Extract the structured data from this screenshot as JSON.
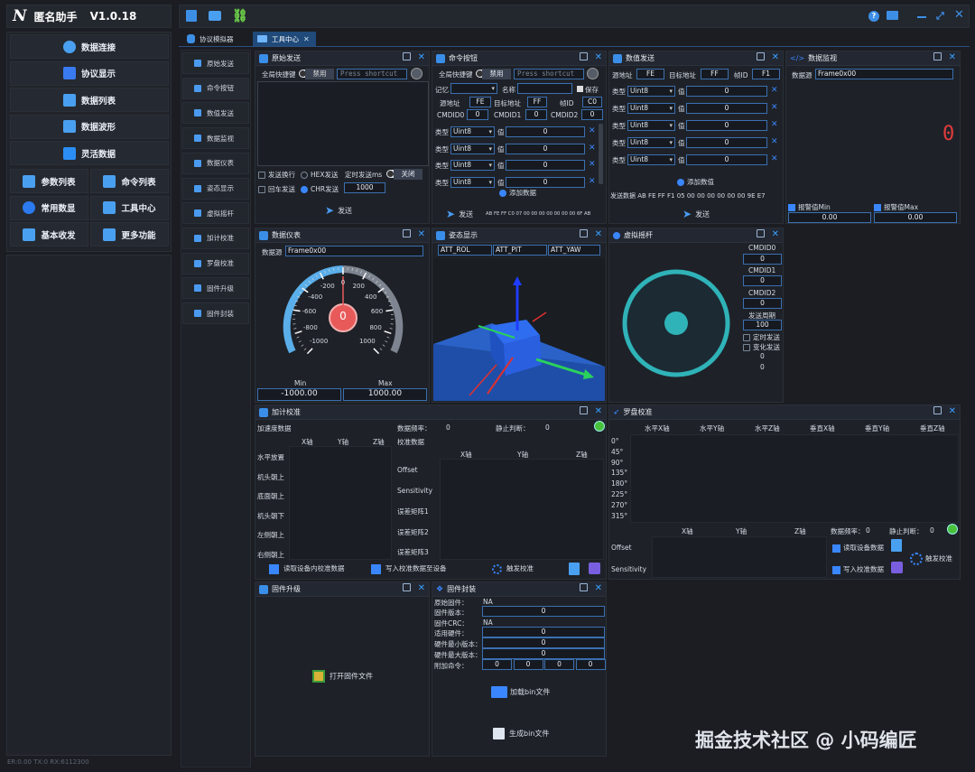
{
  "app": {
    "title": "匿名助手",
    "version": "V1.0.18"
  },
  "status_bar": "ER:0.00 TX:0 RX:6112300",
  "watermark": "掘金技术社区 @ 小码编匠",
  "sidebar": {
    "wide": [
      {
        "label": "数据连接",
        "icon": "link-icon"
      },
      {
        "label": "协议显示",
        "icon": "cube-icon"
      },
      {
        "label": "数据列表",
        "icon": "list-icon"
      },
      {
        "label": "数据波形",
        "icon": "waveform-icon"
      },
      {
        "label": "灵活数据",
        "icon": "cubes-icon"
      }
    ],
    "grid": [
      {
        "label": "参数列表",
        "icon": "sliders-icon"
      },
      {
        "label": "命令列表",
        "icon": "grid-icon"
      },
      {
        "label": "常用数显",
        "icon": "number-one-icon"
      },
      {
        "label": "工具中心",
        "icon": "toolbox-icon"
      },
      {
        "label": "基本收发",
        "icon": "swap-icon"
      },
      {
        "label": "更多功能",
        "icon": "layers-icon"
      }
    ]
  },
  "tabs": [
    {
      "label": "协议模拟器"
    },
    {
      "label": "工具中心"
    }
  ],
  "tool_nav": [
    "原始发送",
    "命令按钮",
    "数值发送",
    "数据监视",
    "数据仪表",
    "姿态显示",
    "虚拟摇杆",
    "加计校准",
    "罗盘校准",
    "固件升级",
    "固件封装"
  ],
  "raw_send": {
    "title": "原始发送",
    "hotkey_label": "全局快捷键",
    "toggle_label": "禁用",
    "shortcut_placeholder": "Press shortcut",
    "opt_newline": "发送换行",
    "opt_hex": "HEX发送",
    "opt_timer": "定时发送ms",
    "timer_state": "关闭",
    "opt_crlf": "回车发送",
    "opt_chr": "CHR发送",
    "interval": "1000",
    "send": "发送"
  },
  "cmd_button": {
    "title": "命令按钮",
    "hotkey_label": "全局快捷键",
    "toggle_label": "禁用",
    "shortcut_placeholder": "Press shortcut",
    "memory": "记忆",
    "name": "名称",
    "save": "保存",
    "src_label": "源地址",
    "src": "FE",
    "dst_label": "目标地址",
    "dst": "FF",
    "fid_label": "帧ID",
    "fid": "C0",
    "cmd0_label": "CMDID0",
    "cmd0": "0",
    "cmd1_label": "CMDID1",
    "cmd1": "0",
    "cmd2_label": "CMDID2",
    "cmd2": "0",
    "rows": [
      {
        "type_label": "类型",
        "type": "Uint8",
        "val_label": "值",
        "val": "0"
      },
      {
        "type_label": "类型",
        "type": "Uint8",
        "val_label": "值",
        "val": "0"
      },
      {
        "type_label": "类型",
        "type": "Uint8",
        "val_label": "值",
        "val": "0"
      },
      {
        "type_label": "类型",
        "type": "Uint8",
        "val_label": "值",
        "val": "0"
      }
    ],
    "add": "添加数据",
    "send": "发送",
    "frame": "AB FE FF C0 07 00 00 00 00 00 00 00 6F AB"
  },
  "value_send": {
    "title": "数值发送",
    "src_label": "源地址",
    "src": "FE",
    "dst_label": "目标地址",
    "dst": "FF",
    "fid_label": "帧ID",
    "fid": "F1",
    "rows": [
      {
        "type": "Uint8",
        "val": "0"
      },
      {
        "type": "Uint8",
        "val": "0"
      },
      {
        "type": "Uint8",
        "val": "0"
      },
      {
        "type": "Uint8",
        "val": "0"
      },
      {
        "type": "Uint8",
        "val": "0"
      }
    ],
    "type_label": "类型",
    "val_label": "值",
    "add": "添加数值",
    "frame": "发送数据 AB FE FF F1 05 00 00 00 00 00 00 9E E7",
    "send": "发送"
  },
  "monitor": {
    "title": "数据监视",
    "source_label": "数据源",
    "source": "Frame0x00",
    "value": "0",
    "min_label": "报警值Min",
    "min": "0.00",
    "max_label": "报警值Max",
    "max": "0.00"
  },
  "gauge": {
    "title": "数据仪表",
    "source_label": "数据源",
    "source": "Frame0x00",
    "ticks": [
      "-1000",
      "-800",
      "-600",
      "-400",
      "-200",
      "0",
      "200",
      "400",
      "600",
      "800",
      "1000"
    ],
    "value": "0",
    "min_label": "Min",
    "min": "-1000.00",
    "max_label": "Max",
    "max": "1000.00"
  },
  "attitude": {
    "title": "姿态显示",
    "fields": [
      "ATT_ROL",
      "ATT_PIT",
      "ATT_YAW"
    ]
  },
  "joystick": {
    "title": "虚拟摇杆",
    "cmd0_label": "CMDID0",
    "cmd0": "0",
    "cmd1_label": "CMDID1",
    "cmd1": "0",
    "cmd2_label": "CMDID2",
    "cmd2": "0",
    "period_label": "发送周期",
    "period": "100",
    "timer": "定时发送",
    "change": "变化发送",
    "out1": "0",
    "out2": "0"
  },
  "accel": {
    "title": "加计校准",
    "data_label": "加速度数据",
    "axes": [
      "X轴",
      "Y轴",
      "Z轴"
    ],
    "freq_label": "数据频率：",
    "freq": "0",
    "static_label": "静止判断：",
    "static": "0",
    "calib_label": "校准数据",
    "poses": [
      "水平放置",
      "机头朝上",
      "底面朝上",
      "机头朝下",
      "左侧朝上",
      "右侧朝上"
    ],
    "params": [
      "Offset",
      "Sensitivity",
      "误差矩阵1",
      "误差矩阵2",
      "误差矩阵3"
    ],
    "read": "读取设备内校准数据",
    "write": "写入校准数据至设备",
    "trigger": "触发校准"
  },
  "compass": {
    "title": "罗盘校准",
    "cols": [
      "水平X轴",
      "水平Y轴",
      "水平Z轴",
      "垂直X轴",
      "垂直Y轴",
      "垂直Z轴"
    ],
    "angles": [
      "0°",
      "45°",
      "90°",
      "135°",
      "180°",
      "225°",
      "270°",
      "315°"
    ],
    "axes": [
      "X轴",
      "Y轴",
      "Z轴"
    ],
    "freq_label": "数据频率：",
    "freq": "0",
    "static_label": "静止判断：",
    "static": "0",
    "params": [
      "Offset",
      "Sensitivity"
    ],
    "read": "读取设备数据",
    "write": "写入校准数据",
    "trigger": "触发校准"
  },
  "fw_upgrade": {
    "title": "固件升级",
    "open": "打开固件文件"
  },
  "fw_pack": {
    "title": "固件封装",
    "orig_label": "原始固件：",
    "orig": "NA",
    "ver_label": "固件版本：",
    "ver": "0",
    "crc_label": "固件CRC：",
    "crc": "NA",
    "hw_label": "适用硬件：",
    "hw": "0",
    "minv_label": "硬件最小版本：",
    "minv": "0",
    "maxv_label": "硬件最大版本：",
    "maxv": "0",
    "extra_label": "附加命令：",
    "extra": [
      "0",
      "0",
      "0",
      "0"
    ],
    "load": "加载bin文件",
    "gen": "生成bin文件"
  }
}
